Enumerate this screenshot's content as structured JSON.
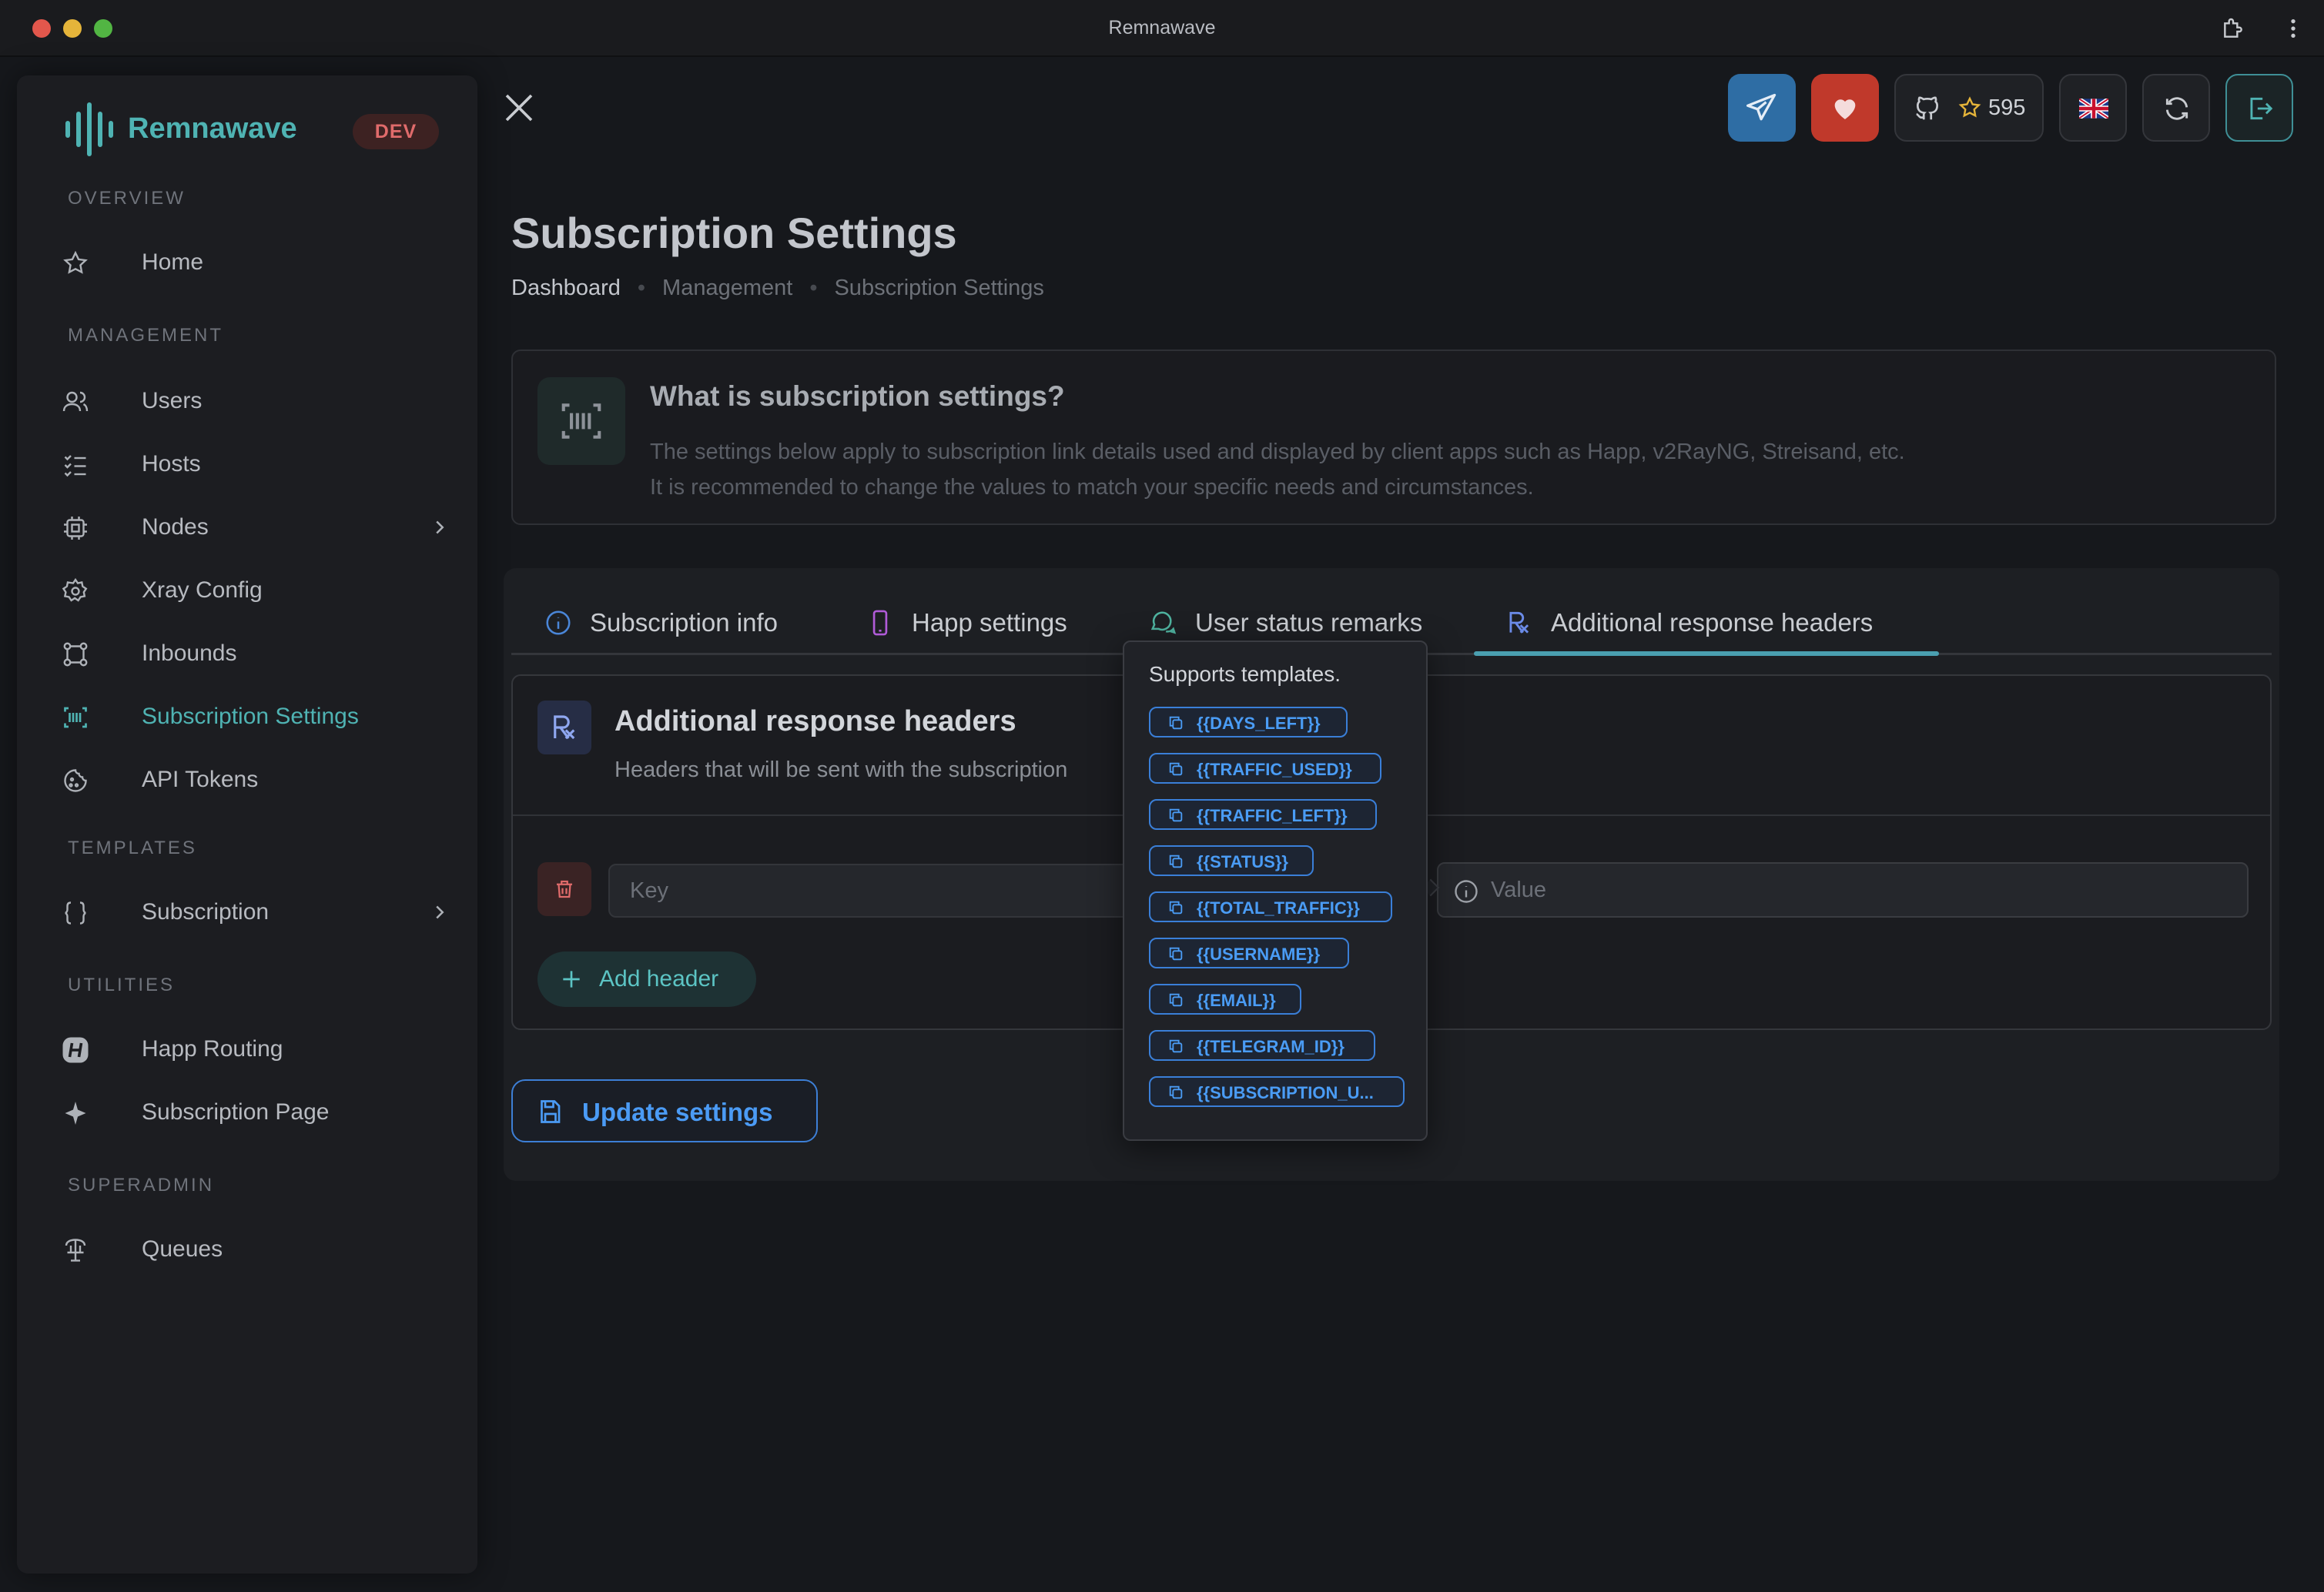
{
  "window": {
    "title": "Remnawave"
  },
  "brand": {
    "name": "Remnawave",
    "badge": "DEV"
  },
  "sidebar": {
    "sections": [
      {
        "label": "OVERVIEW"
      },
      {
        "label": "MANAGEMENT"
      },
      {
        "label": "TEMPLATES"
      },
      {
        "label": "UTILITIES"
      },
      {
        "label": "SUPERADMIN"
      }
    ],
    "items": [
      {
        "label": "Home",
        "icon": "star-icon"
      },
      {
        "label": "Users",
        "icon": "users-icon"
      },
      {
        "label": "Hosts",
        "icon": "list-check-icon"
      },
      {
        "label": "Nodes",
        "icon": "cpu-icon"
      },
      {
        "label": "Xray Config",
        "icon": "gear-icon"
      },
      {
        "label": "Inbounds",
        "icon": "network-icon"
      },
      {
        "label": "Subscription Settings",
        "icon": "barcode-icon"
      },
      {
        "label": "API Tokens",
        "icon": "cookie-icon"
      },
      {
        "label": "Subscription",
        "icon": "braces-icon"
      },
      {
        "label": "Happ Routing",
        "icon": "happ-icon"
      },
      {
        "label": "Subscription Page",
        "icon": "sparkle-icon"
      },
      {
        "label": "Queues",
        "icon": "fountain-icon"
      }
    ],
    "active_item": "Subscription Settings"
  },
  "header": {
    "github_stars": "595",
    "colors": {
      "telegram": "#2e6da4",
      "heart": "#c0392b",
      "accent": "#4fb3b3"
    }
  },
  "page": {
    "title": "Subscription Settings",
    "breadcrumb": [
      "Dashboard",
      "Management",
      "Subscription Settings"
    ]
  },
  "info": {
    "title": "What is subscription settings?",
    "line1": "The settings below apply to subscription link details used and displayed by client apps such as Happ, v2RayNG, Streisand, etc.",
    "line2": "It is recommended to change the values to match your specific needs and circumstances."
  },
  "tabs": [
    {
      "label": "Subscription info",
      "icon": "info-circle-icon"
    },
    {
      "label": "Happ settings",
      "icon": "phone-icon"
    },
    {
      "label": "User status remarks",
      "icon": "chat-icon"
    },
    {
      "label": "Additional response headers",
      "icon": "rx-icon"
    }
  ],
  "active_tab": "Additional response headers",
  "headers_card": {
    "title": "Additional response headers",
    "description": "Headers that will be sent with the subscription",
    "key_placeholder": "Key",
    "value_placeholder": "Value",
    "add_label": "Add header"
  },
  "update_label": "Update settings",
  "popover": {
    "title": "Supports templates.",
    "templates": [
      "{{DAYS_LEFT}}",
      "{{TRAFFIC_USED}}",
      "{{TRAFFIC_LEFT}}",
      "{{STATUS}}",
      "{{TOTAL_TRAFFIC}}",
      "{{USERNAME}}",
      "{{EMAIL}}",
      "{{TELEGRAM_ID}}",
      "{{SUBSCRIPTION_U..."
    ]
  }
}
